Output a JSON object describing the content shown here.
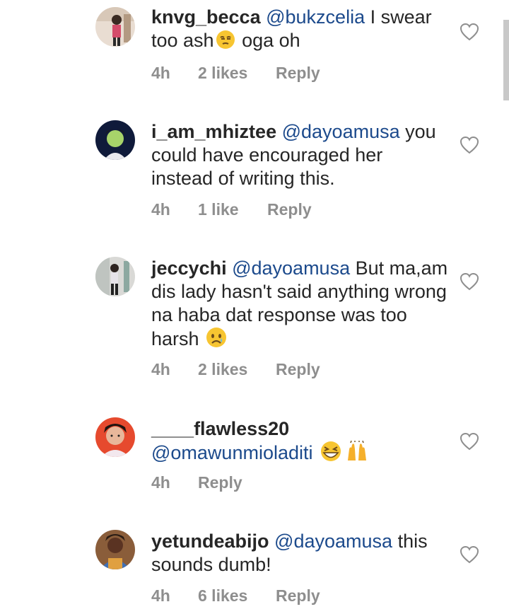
{
  "comments": [
    {
      "username": "knvg_becca",
      "mention": "@bukzcelia",
      "text_before_emoji": "I swear too ash",
      "emoji1": "unamused-face-emoji",
      "text_after_emoji": "oga oh",
      "time": "4h",
      "likes": "2 likes",
      "reply": "Reply"
    },
    {
      "username": "i_am_mhiztee",
      "mention": "@dayoamusa",
      "text": "you could have encouraged her instead of writing this.",
      "time": "4h",
      "likes": "1 like",
      "reply": "Reply"
    },
    {
      "username": "jeccychi",
      "mention": "@dayoamusa",
      "text": "But ma,am dis lady hasn't said anything wrong na haba dat response was too harsh",
      "emoji1": "sad-face-emoji",
      "time": "4h",
      "likes": "2 likes",
      "reply": "Reply"
    },
    {
      "username": "____flawless20",
      "mention": "@omawunmioladiti",
      "emoji1": "grinning-squinting-face-emoji",
      "emoji2": "raising-hands-emoji",
      "time": "4h",
      "reply": "Reply"
    },
    {
      "username": "yetundeabijo",
      "mention": "@dayoamusa",
      "text": "this sounds dumb!",
      "time": "4h",
      "likes": "6 likes",
      "reply": "Reply"
    }
  ],
  "icons": {
    "like": "heart-outline-icon"
  },
  "colors": {
    "text": "#262626",
    "mention": "#1c4a8c",
    "meta": "#8e8e8e"
  }
}
